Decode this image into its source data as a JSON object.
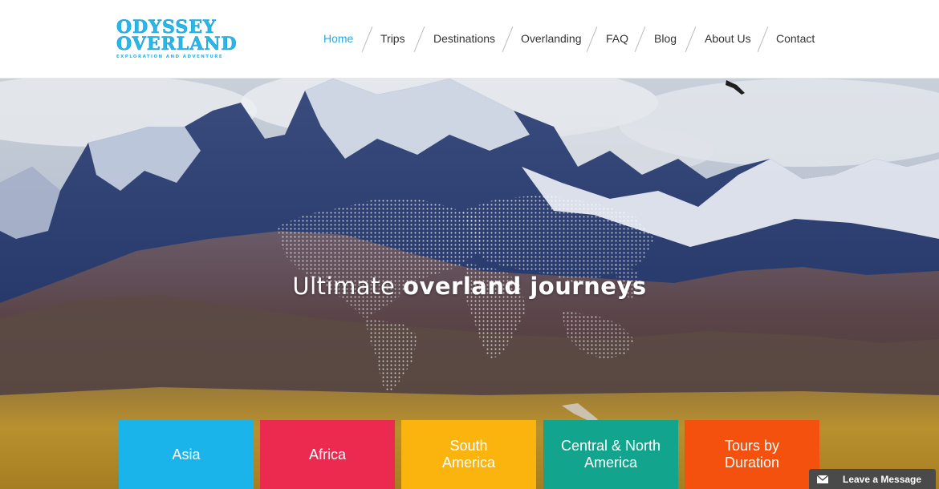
{
  "logo": {
    "line1": "ODYSSEY",
    "line2": "OVERLAND",
    "tagline": "EXPLORATION AND ADVENTURE"
  },
  "nav": {
    "items": [
      {
        "label": "Home",
        "active": true
      },
      {
        "label": "Trips",
        "active": false
      },
      {
        "label": "Destinations",
        "active": false
      },
      {
        "label": "Overlanding",
        "active": false
      },
      {
        "label": "FAQ",
        "active": false
      },
      {
        "label": "Blog",
        "active": false
      },
      {
        "label": "About Us",
        "active": false
      },
      {
        "label": "Contact",
        "active": false
      }
    ],
    "active_color": "#29a9e0"
  },
  "hero": {
    "title_light": "Ultimate",
    "title_bold": "overland journeys"
  },
  "tiles": [
    {
      "label": "Asia",
      "color": "#1ab3ea"
    },
    {
      "label": "Africa",
      "color": "#ec2a50"
    },
    {
      "label": "South America",
      "color": "#fbb40d"
    },
    {
      "label": "Central & North America",
      "color": "#13a48e"
    },
    {
      "label": "Tours by Duration",
      "color": "#f4510f"
    }
  ],
  "chat": {
    "label": "Leave a Message",
    "icon": "envelope-icon"
  }
}
